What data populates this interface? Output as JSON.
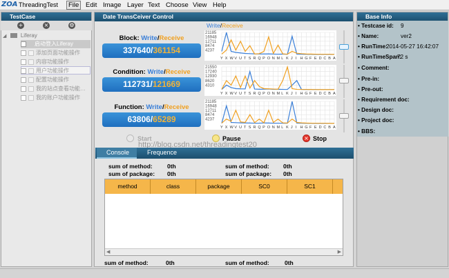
{
  "menubar": {
    "logo": "ZOA",
    "app_title": "ThreadingTest",
    "items": [
      "File",
      "Edit",
      "Image",
      "Layer",
      "Text",
      "Choose",
      "View",
      "Help"
    ]
  },
  "left": {
    "header": "TestCase",
    "tool_icons": [
      "add-icon",
      "remove-icon",
      "settings-icon"
    ],
    "root": "Liferay",
    "items": [
      "启动登入Liferay",
      "添加页面功能操作",
      "内容功能操作",
      "用户功能操作",
      "配置功能操作",
      "我的站点查看功能…",
      "我的账户功能操作"
    ]
  },
  "center": {
    "header": "Date TransCeiver Control",
    "legend_write": "Write",
    "legend_slash": "/",
    "legend_receive": "Receive",
    "panels": [
      {
        "label": "Block:",
        "write": "337640",
        "receive": "361154",
        "yticks": [
          "21185",
          "16948",
          "12711",
          "8474",
          "4237"
        ]
      },
      {
        "label": "Condition:",
        "write": "112731",
        "receive": "121669",
        "yticks": [
          "21550",
          "17240",
          "12930",
          "8620",
          "4310"
        ]
      },
      {
        "label": "Function:",
        "write": "63806",
        "receive": "65289",
        "yticks": [
          "21185",
          "16948",
          "12711",
          "8474",
          "4237"
        ]
      }
    ],
    "write_word": "Write",
    "receive_word": "Receive",
    "controls": {
      "start": "Start",
      "pause": "Pause",
      "stop": "Stop"
    },
    "watermark": "http://blog.csdn.net/threadingtest20",
    "tabs": [
      "Console",
      "Frequence"
    ],
    "sum_method_label": "sum of method:",
    "sum_package_label": "sum of package:",
    "sum_val": "0th",
    "table_headers": [
      "method",
      "class",
      "package",
      "SC0",
      "SC1"
    ]
  },
  "chart_data": [
    {
      "type": "line",
      "categories": [
        "Y",
        "X",
        "W",
        "V",
        "U",
        "T",
        "S",
        "R",
        "Q",
        "P",
        "O",
        "N",
        "M",
        "L",
        "K",
        "J",
        "I",
        "H",
        "G",
        "F",
        "E",
        "D",
        "C",
        "B",
        "A"
      ],
      "ylim": [
        0,
        21185
      ],
      "series": [
        {
          "values": [
            3000,
            21185,
            3000,
            2000,
            1500,
            1000,
            800,
            600,
            500,
            500,
            600,
            400,
            300,
            400,
            200,
            17500,
            300,
            200,
            150,
            120,
            100,
            100,
            100,
            100,
            100
          ]
        },
        {
          "values": [
            400,
            4237,
            14000,
            4237,
            12711,
            3000,
            8474,
            500,
            800,
            3000,
            16948,
            1000,
            9000,
            600,
            300,
            3000,
            1200,
            800,
            500,
            400,
            300,
            200,
            200,
            200,
            100
          ]
        }
      ]
    },
    {
      "type": "line",
      "categories": [
        "Y",
        "X",
        "W",
        "V",
        "U",
        "T",
        "S",
        "R",
        "Q",
        "P",
        "O",
        "N",
        "M",
        "L",
        "K",
        "J",
        "I",
        "H",
        "G",
        "F",
        "E",
        "D",
        "C",
        "B",
        "A"
      ],
      "ylim": [
        0,
        21550
      ],
      "series": [
        {
          "values": [
            200,
            4310,
            2000,
            1000,
            800,
            700,
            17240,
            600,
            400,
            500,
            600,
            300,
            400,
            300,
            200,
            4310,
            8620,
            200,
            150,
            120,
            100,
            100,
            100,
            100,
            100
          ]
        },
        {
          "values": [
            400,
            8620,
            4310,
            12930,
            2000,
            12930,
            1500,
            8620,
            3000,
            1000,
            800,
            600,
            400,
            8620,
            21550,
            1000,
            300,
            200,
            200,
            150,
            120,
            100,
            100,
            100,
            100
          ]
        }
      ]
    },
    {
      "type": "line",
      "categories": [
        "Y",
        "X",
        "W",
        "V",
        "U",
        "T",
        "S",
        "R",
        "Q",
        "P",
        "O",
        "N",
        "M",
        "L",
        "K",
        "J",
        "I",
        "H",
        "G",
        "F",
        "E",
        "D",
        "C",
        "B",
        "A"
      ],
      "ylim": [
        0,
        21185
      ],
      "series": [
        {
          "values": [
            200,
            16948,
            1000,
            800,
            600,
            500,
            400,
            300,
            300,
            500,
            400,
            300,
            300,
            200,
            200,
            21185,
            300,
            200,
            150,
            120,
            100,
            100,
            100,
            100,
            100
          ]
        },
        {
          "values": [
            300,
            4237,
            2000,
            12711,
            1500,
            1000,
            8474,
            800,
            4237,
            600,
            12711,
            1000,
            4237,
            600,
            400,
            4237,
            1000,
            600,
            400,
            300,
            200,
            200,
            200,
            100,
            100
          ]
        }
      ]
    }
  ],
  "table": {
    "bottom_method_label": "sum of method:",
    "bottom_val": "0th"
  },
  "right": {
    "header": "Base Info",
    "items": [
      {
        "label": "Testcase id:",
        "value": "9"
      },
      {
        "label": "Name:",
        "value": "ver2"
      },
      {
        "label": "RunTime:",
        "value": "2014-05-27 16:42:07"
      },
      {
        "label": "RunTimeSpan:",
        "value": "72 s"
      },
      {
        "label": "Comment:",
        "value": ""
      },
      {
        "label": "Pre-in:",
        "value": ""
      },
      {
        "label": "Pre-out:",
        "value": ""
      },
      {
        "label": "Requirement doc:",
        "value": ""
      },
      {
        "label": "Design doc:",
        "value": ""
      },
      {
        "label": "Project doc:",
        "value": ""
      },
      {
        "label": "BBS:",
        "value": ""
      }
    ]
  },
  "colors": {
    "write": "#3a7fd8",
    "receive": "#f0a020"
  }
}
